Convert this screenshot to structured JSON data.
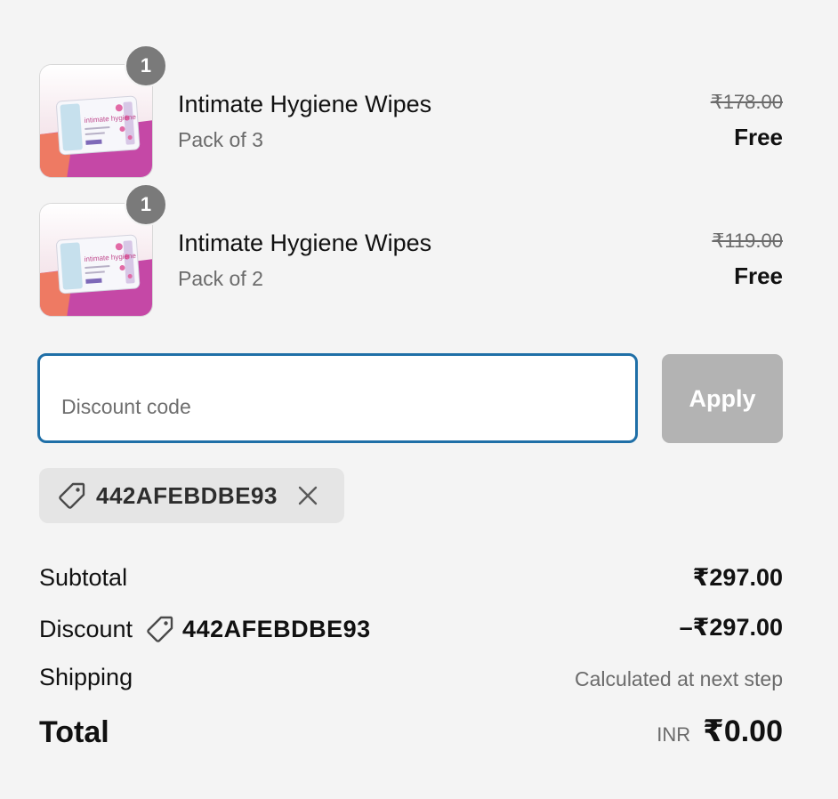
{
  "line_items": [
    {
      "quantity": "1",
      "title": "Intimate Hygiene Wipes",
      "variant": "Pack of 3",
      "original_price": "₹178.00",
      "price": "Free",
      "image_text": "intimate hygiene"
    },
    {
      "quantity": "1",
      "title": "Intimate Hygiene Wipes",
      "variant": "Pack of 2",
      "original_price": "₹119.00",
      "price": "Free",
      "image_text": "intimate hygiene"
    }
  ],
  "discount_form": {
    "placeholder": "Discount code",
    "value": "",
    "apply_label": "Apply"
  },
  "applied_code": {
    "code": "442AFEBDBE93",
    "icon": "tag-icon",
    "remove_icon": "close-icon"
  },
  "summary": {
    "subtotal_label": "Subtotal",
    "subtotal_value": "₹297.00",
    "discount_label": "Discount",
    "discount_code": "442AFEBDBE93",
    "discount_value": "–₹297.00",
    "shipping_label": "Shipping",
    "shipping_value": "Calculated at next step",
    "total_label": "Total",
    "total_currency": "INR",
    "total_value": "₹0.00"
  },
  "colors": {
    "focus_border": "#1f6fa7",
    "apply_disabled": "#b3b3b3",
    "chip_bg": "#e5e5e5",
    "badge_bg": "#7a7a7a",
    "page_bg": "#f4f4f4"
  }
}
